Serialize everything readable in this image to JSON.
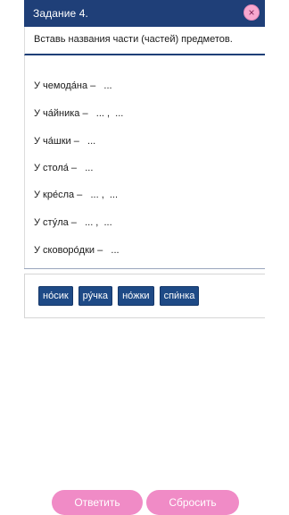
{
  "header": {
    "title": "Задание 4.",
    "close_icon": "×"
  },
  "instruction": "Вставь названия части (частей) предметов.",
  "tasks": [
    {
      "text": "У чемода́на –   ..."
    },
    {
      "text": "У ча́йника –   ... ,  ..."
    },
    {
      "text": "У ча́шки –   ..."
    },
    {
      "text": "У стола́ –   ..."
    },
    {
      "text": "У кре́сла –   ... ,  ..."
    },
    {
      "text": "У сту́ла –   ... ,  ..."
    },
    {
      "text": "У сковоро́дки –   ..."
    }
  ],
  "word_bank": [
    {
      "label": "но́сик"
    },
    {
      "label": "ру́чка"
    },
    {
      "label": "но́жки"
    },
    {
      "label": "спи́нка"
    }
  ],
  "footer": {
    "answer_label": "Ответить",
    "reset_label": "Сбросить"
  },
  "colors": {
    "header": "#1f3f78",
    "chip": "#1e4a86",
    "button": "#f08bc6",
    "close": "#f7a8cf"
  }
}
